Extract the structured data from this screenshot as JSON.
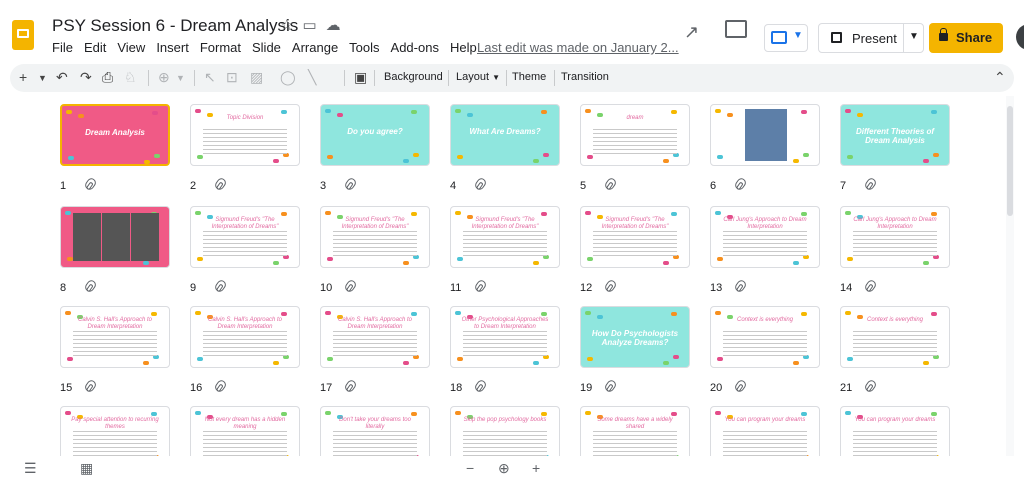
{
  "header": {
    "title": "PSY Session 6 - Dream Analysis",
    "title_icons": [
      "star-icon",
      "move-to-folder-icon",
      "cloud-status-icon"
    ],
    "menu": [
      "File",
      "Edit",
      "View",
      "Insert",
      "Format",
      "Slide",
      "Arrange",
      "Tools",
      "Add-ons",
      "Help"
    ],
    "last_edit": "Last edit was made on January 2...",
    "present_label": "Present",
    "share_label": "Share"
  },
  "toolbar": {
    "background": "Background",
    "layout": "Layout",
    "theme": "Theme",
    "transition": "Transition"
  },
  "slides": [
    {
      "num": "1",
      "title": "Dream Analysis",
      "style": "pink"
    },
    {
      "num": "2",
      "title": "Topic Division",
      "style": "white"
    },
    {
      "num": "3",
      "title": "Do you agree?",
      "style": "aqua"
    },
    {
      "num": "4",
      "title": "What Are Dreams?",
      "style": "aqua"
    },
    {
      "num": "5",
      "title": "dream",
      "style": "white"
    },
    {
      "num": "6",
      "title": "",
      "style": "white"
    },
    {
      "num": "7",
      "title": "Different Theories of Dream Analysis",
      "style": "aqua"
    },
    {
      "num": "8",
      "title": "",
      "style": "pink"
    },
    {
      "num": "9",
      "title": "Sigmund Freud's \"The Interpretation of Dreams\"",
      "style": "white"
    },
    {
      "num": "10",
      "title": "Sigmund Freud's \"The Interpretation of Dreams\"",
      "style": "white"
    },
    {
      "num": "11",
      "title": "Sigmund Freud's \"The Interpretation of Dreams\"",
      "style": "white"
    },
    {
      "num": "12",
      "title": "Sigmund Freud's \"The Interpretation of Dreams\"",
      "style": "white"
    },
    {
      "num": "13",
      "title": "Carl Jung's Approach to Dream Interpretation",
      "style": "white"
    },
    {
      "num": "14",
      "title": "Carl Jung's Approach to Dream Interpretation",
      "style": "white"
    },
    {
      "num": "15",
      "title": "Calvin S. Hall's Approach to Dream Interpretation",
      "style": "white"
    },
    {
      "num": "16",
      "title": "Calvin S. Hall's Approach to Dream Interpretation",
      "style": "white"
    },
    {
      "num": "17",
      "title": "Calvin S. Hall's Approach to Dream Interpretation",
      "style": "white"
    },
    {
      "num": "18",
      "title": "Other Psychological Approaches to Dream Interpretation",
      "style": "white"
    },
    {
      "num": "19",
      "title": "How Do Psychologists Analyze Dreams?",
      "style": "aqua"
    },
    {
      "num": "20",
      "title": "Context is everything",
      "style": "white"
    },
    {
      "num": "21",
      "title": "Context is everything",
      "style": "white"
    },
    {
      "num": "",
      "title": "Pay special attention to recurring themes",
      "style": "white"
    },
    {
      "num": "",
      "title": "Not every dream has a hidden meaning",
      "style": "white"
    },
    {
      "num": "",
      "title": "Don't take your dreams too literally",
      "style": "white"
    },
    {
      "num": "",
      "title": "Skip the pop psychology books",
      "style": "white"
    },
    {
      "num": "",
      "title": "Some dreams have a widely shared",
      "style": "white"
    },
    {
      "num": "",
      "title": "You can program your dreams",
      "style": "white"
    },
    {
      "num": "",
      "title": "You can program your dreams",
      "style": "white"
    }
  ],
  "colors": {
    "accent": "#f4b400",
    "pink": "#f05a86",
    "aqua": "#8fe6de",
    "blue": "#1a73e8"
  }
}
